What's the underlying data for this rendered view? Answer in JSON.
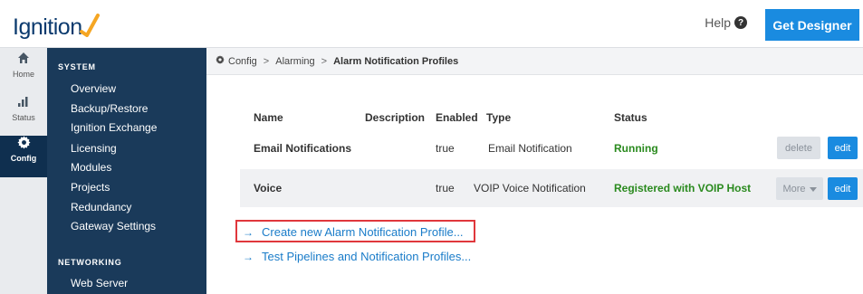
{
  "header": {
    "logo_text": "Ignition",
    "help_label": "Help",
    "help_icon": "?",
    "get_designer_label": "Get Designer"
  },
  "leftnav": {
    "items": [
      {
        "label": "Home",
        "icon": "home-icon"
      },
      {
        "label": "Status",
        "icon": "bar-chart-icon"
      },
      {
        "label": "Config",
        "icon": "gear-icon"
      }
    ]
  },
  "sidebar": {
    "system_title": "SYSTEM",
    "system_items": [
      "Overview",
      "Backup/Restore",
      "Ignition Exchange",
      "Licensing",
      "Modules",
      "Projects",
      "Redundancy",
      "Gateway Settings"
    ],
    "networking_title": "NETWORKING",
    "networking_items": [
      "Web Server"
    ]
  },
  "breadcrumb": {
    "items": [
      "Config",
      "Alarming",
      "Alarm Notification Profiles"
    ],
    "separator": ">"
  },
  "table": {
    "headers": [
      "Name",
      "Description",
      "Enabled",
      "Type",
      "Status"
    ],
    "rows": [
      {
        "name": "Email Notifications",
        "description": "",
        "enabled": "true",
        "type": "Email Notification",
        "status": "Running",
        "buttons": [
          "delete",
          "edit"
        ]
      },
      {
        "name": "Voice",
        "description": "",
        "enabled": "true",
        "type": "VOIP Voice Notification",
        "status": "Registered with VOIP Host",
        "buttons": [
          "More",
          "edit"
        ]
      }
    ]
  },
  "links": {
    "create": "Create new Alarm Notification Profile...",
    "test": "Test Pipelines and Notification Profiles...",
    "arrow": "→"
  },
  "colors": {
    "sidebar_bg": "#1a3a5a",
    "accent_blue": "#1a8be0",
    "status_green": "#2a8a1e",
    "highlight_red": "#e0373c"
  }
}
